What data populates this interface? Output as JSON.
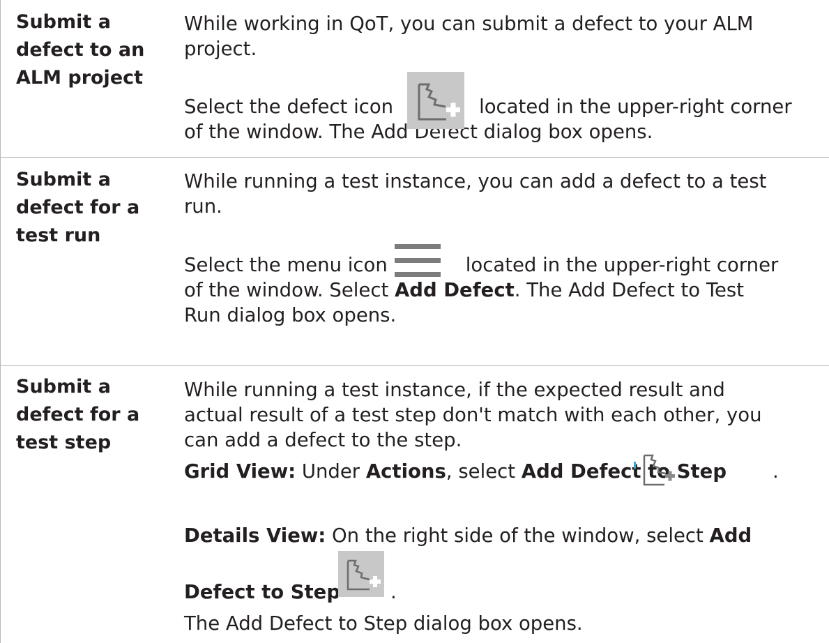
{
  "rows": [
    {
      "heading": [
        "Submit a",
        "defect to an",
        "ALM project"
      ],
      "intro": [
        "While working in QoT, you can submit a defect to your ALM",
        "project."
      ],
      "select_a": "Select the defect icon",
      "select_b": "located in the upper-right corner",
      "select_c": "of the window. The Add Defect dialog box opens.",
      "icon": "add-defect-icon"
    },
    {
      "heading": [
        "Submit a",
        "defect for a",
        "test run"
      ],
      "intro": [
        "While running a test instance, you can add a defect to a test",
        "run."
      ],
      "select_a": "Select the menu icon",
      "select_b": "located in the upper-right corner",
      "select_c1": "of the window. Select ",
      "select_c_bold": "Add Defect",
      "select_c2": ". The Add Defect to Test",
      "select_d": "Run dialog box opens.",
      "icon": "menu-icon"
    },
    {
      "heading": [
        "Submit a",
        "defect for a",
        "test step"
      ],
      "intro": [
        "While running a test instance, if the expected result and",
        "actual result of a test step don't match with each other, you",
        "can add a defect to the step."
      ],
      "grid_label": "Grid View:",
      "grid_t1": " Under ",
      "grid_actions": "Actions",
      "grid_t2": ", select ",
      "grid_add": "Add Defect to Step",
      "grid_end": ".",
      "details_label": "Details View:",
      "details_t1": " On the right side of the window, select ",
      "details_add": "Add",
      "details_add2": "Defect to Step",
      "details_end": ".",
      "closing": "The Add Defect to Step dialog box opens.",
      "icon": "add-defect-icon"
    }
  ],
  "colors": {
    "border": "#b7b7b7",
    "text": "#231f20",
    "icon_tile": "#c8c8c8",
    "icon_stroke": "#6d6d6d",
    "icon_plus": "#8a8a8a"
  }
}
